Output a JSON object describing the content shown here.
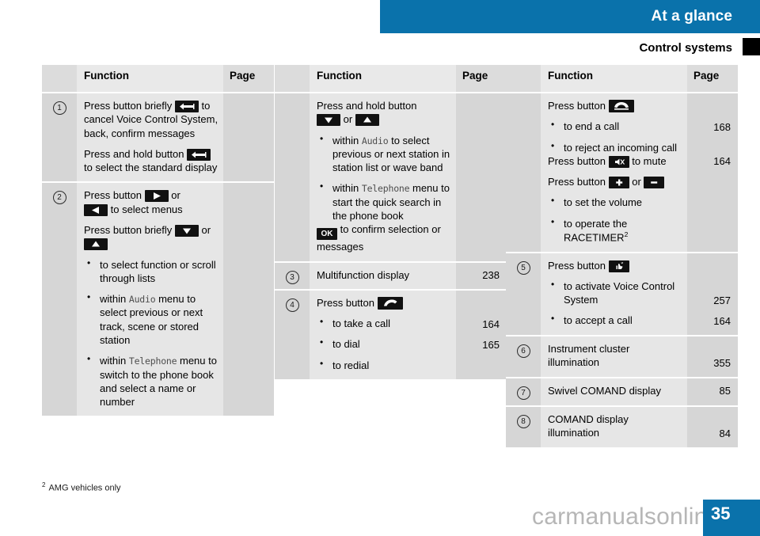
{
  "header": {
    "title": "At a glance",
    "subtitle": "Control systems"
  },
  "table_headers": {
    "function": "Function",
    "page": "Page"
  },
  "columns": [
    {
      "id": "column-1",
      "rows": [
        {
          "number": "1",
          "blocks": [
            {
              "type": "para",
              "text_before": "Press button briefly ",
              "icon": "back-button-icon",
              "text_after": " to cancel Voice Control System, back, confirm messages"
            },
            {
              "type": "para",
              "text_before": "Press and hold button ",
              "icon": "back-button-icon",
              "text_after": " to select the standard display"
            }
          ],
          "pages": []
        },
        {
          "number": "2",
          "blocks": [
            {
              "type": "para",
              "text_before": "Press button ",
              "icon": "arrow-right-icon",
              "text_mid": " or ",
              "icon2": "arrow-left-icon",
              "text_after": " to select menus"
            },
            {
              "type": "para",
              "text_before": "Press button briefly ",
              "icon": "arrow-down-icon",
              "text_mid": " or ",
              "icon2": "arrow-up-icon",
              "text_after": ""
            },
            {
              "type": "bullets",
              "items": [
                {
                  "text": "to select function or scroll through lists"
                },
                {
                  "pre": "within ",
                  "mono": "Audio",
                  "post": " menu to select previous or next track, scene or stored station"
                },
                {
                  "pre": "within ",
                  "mono": "Telephone",
                  "post": " menu to switch to the phone book and select a name or number"
                }
              ]
            }
          ],
          "pages": []
        }
      ]
    },
    {
      "id": "column-2",
      "rows": [
        {
          "number": "",
          "blocks": [
            {
              "type": "para",
              "text_before": "Press and hold button ",
              "icon": "arrow-down-icon",
              "text_mid": " or ",
              "icon2": "arrow-up-icon",
              "text_after": ""
            },
            {
              "type": "bullets",
              "items": [
                {
                  "pre": "within ",
                  "mono": "Audio",
                  "post": " to select previous or next station in station list or wave band"
                },
                {
                  "pre": "within ",
                  "mono": "Telephone",
                  "post": " menu to start the quick search in the phone book"
                }
              ]
            },
            {
              "type": "para",
              "icon": "ok-button-icon",
              "text_after": " to confirm selection or messages"
            }
          ],
          "pages": []
        },
        {
          "number": "3",
          "blocks": [
            {
              "type": "para",
              "text_after": "Multifunction display"
            }
          ],
          "pages": [
            "238"
          ]
        },
        {
          "number": "4",
          "blocks": [
            {
              "type": "para",
              "text_before": "Press button ",
              "icon": "phone-accept-icon",
              "text_after": ""
            },
            {
              "type": "bullets",
              "items": [
                {
                  "text": "to take a call"
                },
                {
                  "text": "to dial"
                },
                {
                  "text": "to redial"
                }
              ]
            }
          ],
          "pages": [
            "",
            "164",
            "165",
            ""
          ]
        }
      ]
    },
    {
      "id": "column-3",
      "rows": [
        {
          "number": "",
          "blocks": [
            {
              "type": "para",
              "text_before": "Press button ",
              "icon": "phone-end-icon",
              "text_after": ""
            },
            {
              "type": "bullets",
              "items": [
                {
                  "text": "to end a call"
                },
                {
                  "text": "to reject an incoming call"
                }
              ]
            },
            {
              "type": "para",
              "text_before": "Press button ",
              "icon": "mute-icon",
              "text_after": " to mute"
            },
            {
              "type": "para",
              "text_before": "Press button ",
              "icon": "volume-up-icon",
              "text_mid": " or ",
              "icon2": "volume-down-icon",
              "text_after": ""
            },
            {
              "type": "bullets",
              "items": [
                {
                  "text": "to set the volume"
                },
                {
                  "text": "to operate the RACETIMER",
                  "sup": "2"
                }
              ]
            }
          ],
          "pages": [
            "168",
            "164"
          ]
        },
        {
          "number": "5",
          "blocks": [
            {
              "type": "para",
              "text_before": "Press button ",
              "icon": "voice-control-icon",
              "text_after": ""
            },
            {
              "type": "bullets",
              "items": [
                {
                  "text": "to activate Voice Control System"
                },
                {
                  "text": "to accept a call"
                }
              ]
            }
          ],
          "pages": [
            "257",
            "164"
          ]
        },
        {
          "number": "6",
          "blocks": [
            {
              "type": "para",
              "text_after": "Instrument cluster illumination"
            }
          ],
          "pages": [
            "355"
          ]
        },
        {
          "number": "7",
          "blocks": [
            {
              "type": "para",
              "text_after": "Swivel COMAND display"
            }
          ],
          "pages": [
            "85"
          ]
        },
        {
          "number": "8",
          "blocks": [
            {
              "type": "para",
              "text_after": "COMAND display illumination"
            }
          ],
          "pages": [
            "84"
          ]
        }
      ]
    }
  ],
  "footnote": {
    "marker": "2",
    "text": "AMG vehicles only"
  },
  "page_number": "35",
  "watermark": "carmanualsonline.info",
  "colors": {
    "accent": "#0a72ab",
    "header_row": "#dcdcdc",
    "num_cell": "#d6d6d6",
    "fn_cell": "#e6e6e6",
    "key_black": "#111111"
  }
}
